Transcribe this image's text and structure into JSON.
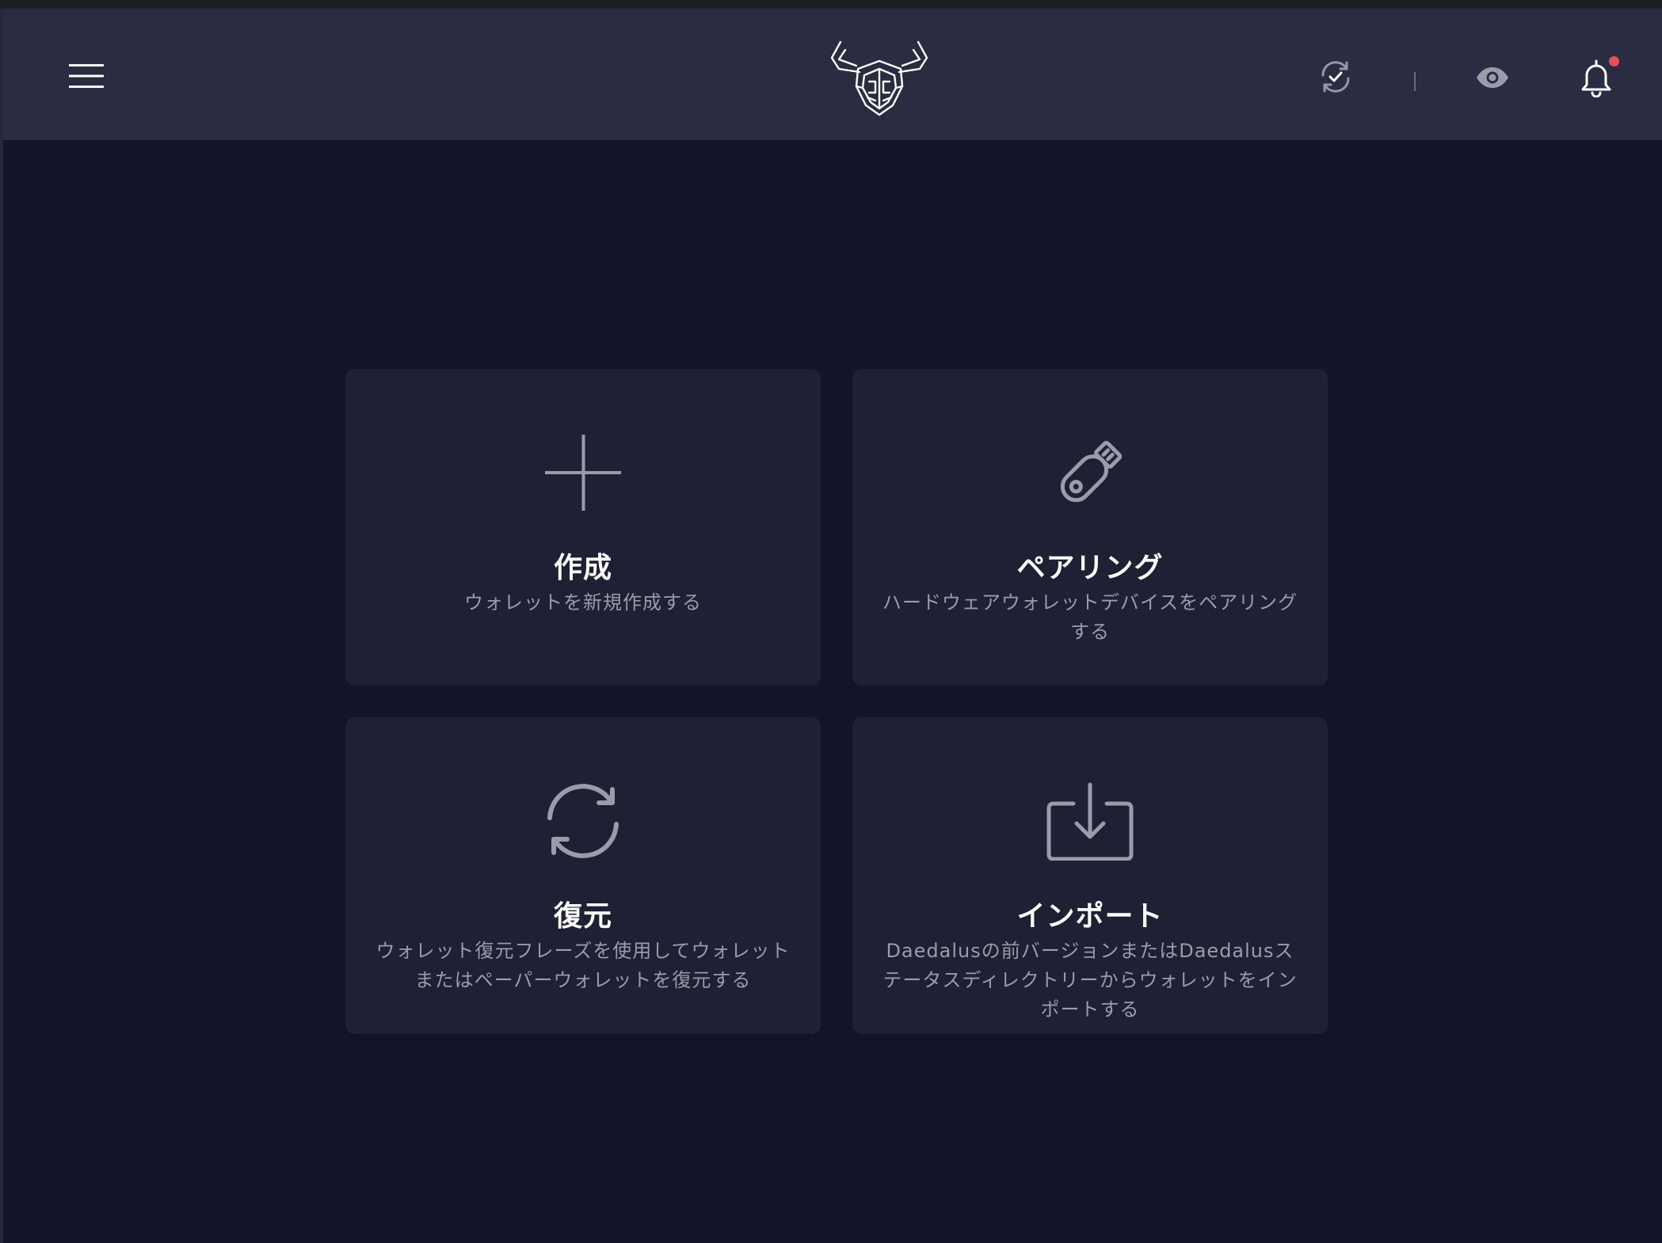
{
  "header": {
    "menu_icon": "hamburger-menu-icon",
    "logo_icon": "daedalus-logo-icon",
    "sync_icon": "sync-status-icon",
    "eye_icon": "eye-icon",
    "bell_icon": "bell-icon",
    "accent_color": "#ea4c5b"
  },
  "cards": [
    {
      "icon": "plus-icon",
      "title": "作成",
      "description": "ウォレットを新規作成する"
    },
    {
      "icon": "usb-key-icon",
      "title": "ペアリング",
      "description": "ハードウェアウォレットデバイスをペアリングする"
    },
    {
      "icon": "restore-icon",
      "title": "復元",
      "description": "ウォレット復元フレーズを使用してウォレットまたはペーパーウォレットを復元する"
    },
    {
      "icon": "import-icon",
      "title": "インポート",
      "description": "Daedalusの前バージョンまたはDaedalusステータスディレクトリーからウォレットをインポートする"
    }
  ],
  "colors": {
    "background": "#121428",
    "header": "#2a2d41",
    "card": "#1e2033",
    "text_primary": "#ffffff",
    "text_secondary": "#9a9caa"
  }
}
